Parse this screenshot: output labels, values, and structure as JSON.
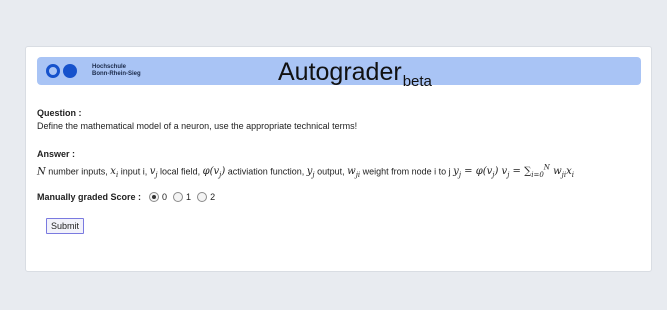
{
  "header": {
    "university_line1": "Hochschule",
    "university_line2": "Bonn-Rhein-Sieg",
    "app_title": "Autograder",
    "app_title_suffix": "beta",
    "banner_color": "#a9c4f5",
    "logo_color": "#1652cc"
  },
  "question": {
    "label": "Question :",
    "text": "Define the mathematical model of a neuron, use the appropriate technical terms!"
  },
  "answer": {
    "label": "Answer :",
    "parts": {
      "t1": " number inputs, ",
      "t2": " input i, ",
      "t3": " local field, ",
      "t4": " activiation function, ",
      "t5": " output, ",
      "t6": " weight from node i to j "
    }
  },
  "score": {
    "label": "Manually graded Score :",
    "options": [
      "0",
      "1",
      "2"
    ],
    "selected": "0"
  },
  "submit_label": "Submit"
}
